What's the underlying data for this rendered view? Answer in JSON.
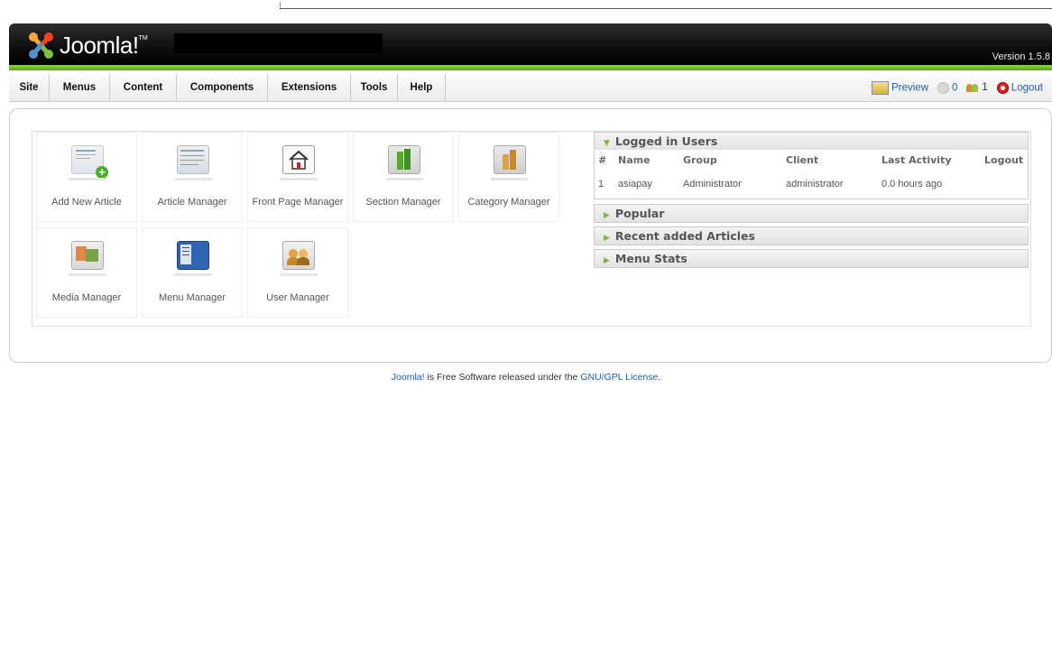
{
  "header": {
    "logo_text": "Joomla!",
    "logo_tm": "TM",
    "version": "Version 1.5.8"
  },
  "menu": [
    {
      "label": "Site"
    },
    {
      "label": "Menus"
    },
    {
      "label": "Content"
    },
    {
      "label": "Components"
    },
    {
      "label": "Extensions"
    },
    {
      "label": "Tools"
    },
    {
      "label": "Help"
    }
  ],
  "status": {
    "preview": "Preview",
    "messages": "0",
    "users": "1",
    "logout": "Logout"
  },
  "cpanel": [
    {
      "label": "Add New Article",
      "icon": "add-article-icon"
    },
    {
      "label": "Article Manager",
      "icon": "article-manager-icon"
    },
    {
      "label": "Front Page Manager",
      "icon": "frontpage-icon"
    },
    {
      "label": "Section Manager",
      "icon": "section-icon"
    },
    {
      "label": "Category Manager",
      "icon": "category-icon"
    },
    {
      "label": "Media Manager",
      "icon": "media-icon"
    },
    {
      "label": "Menu Manager",
      "icon": "menu-manager-icon"
    },
    {
      "label": "User Manager",
      "icon": "user-manager-icon"
    }
  ],
  "logged_in": {
    "title": "Logged in Users",
    "columns": [
      "#",
      "Name",
      "Group",
      "Client",
      "Last Activity",
      "Logout"
    ],
    "rows": [
      {
        "num": "1",
        "name": "asiapay",
        "group": "Administrator",
        "client": "administrator",
        "activity": "0.0 hours ago",
        "logout": ""
      }
    ]
  },
  "panels": {
    "popular": "Popular",
    "recent": "Recent added Articles",
    "menu_stats": "Menu Stats"
  },
  "footer": {
    "brand": "Joomla!",
    "middle": " is Free Software released under the ",
    "license": "GNU/GPL License",
    "end": "."
  },
  "colors": {
    "accent_green": "#6ab82a",
    "link_blue": "#1b5ea8"
  }
}
